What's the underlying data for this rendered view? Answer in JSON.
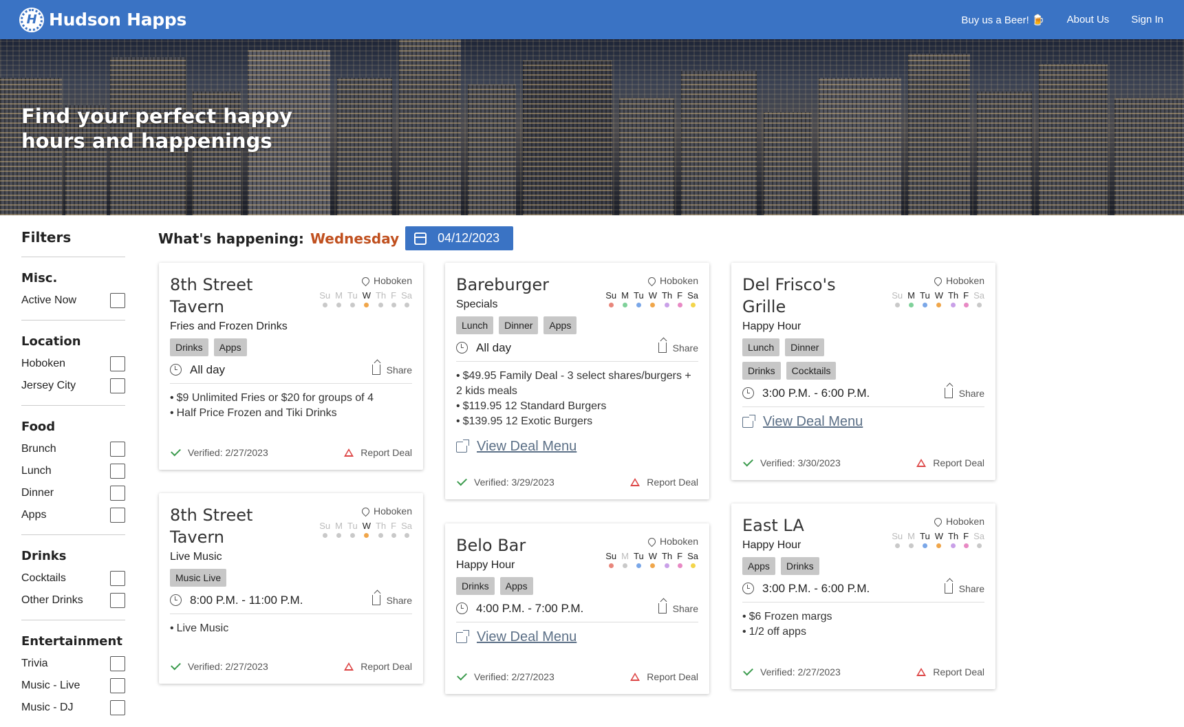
{
  "nav": {
    "brand": "Hudson Happs",
    "links": [
      "Buy us a Beer! 🍺",
      "About Us",
      "Sign In"
    ]
  },
  "hero": {
    "title_line1": "Find your perfect happy",
    "title_line2": "hours and happenings"
  },
  "filters": {
    "title": "Filters",
    "groups": [
      {
        "name": "Misc.",
        "items": [
          "Active Now"
        ]
      },
      {
        "name": "Location",
        "items": [
          "Hoboken",
          "Jersey City"
        ]
      },
      {
        "name": "Food",
        "items": [
          "Brunch",
          "Lunch",
          "Dinner",
          "Apps"
        ]
      },
      {
        "name": "Drinks",
        "items": [
          "Cocktails",
          "Other Drinks"
        ]
      },
      {
        "name": "Entertainment",
        "items": [
          "Trivia",
          "Music - Live",
          "Music - DJ"
        ]
      }
    ]
  },
  "header": {
    "label": "What's happening:",
    "day": "Wednesday",
    "date": "04/12/2023"
  },
  "colors": {
    "brand": "#3a73c4",
    "day_highlight": "#c0501f",
    "verified": "#3a9a4c",
    "report": "#dd4444"
  },
  "cards": [
    {
      "name_l1": "8th Street",
      "name_l2": "Tavern",
      "location": "Hoboken",
      "subtitle": "Fries and Frozen Drinks",
      "tags": [
        "Drinks",
        "Apps"
      ],
      "time": "All day",
      "share": "Share",
      "deals": [
        "$9 Unlimited Fries or $20 for groups of 4",
        "Half Price Frozen and Tiki Drinks"
      ],
      "verified": "Verified: 2/27/2023",
      "report": "Report Deal"
    },
    {
      "name_l1": "8th Street",
      "name_l2": "Tavern",
      "location": "Hoboken",
      "subtitle": "Live Music",
      "tags": [
        "Music Live"
      ],
      "time": "8:00 P.M. - 11:00 P.M.",
      "share": "Share",
      "deals": [
        "Live Music"
      ],
      "verified": "Verified: 2/27/2023",
      "report": "Report Deal"
    },
    {
      "name_l1": "Bareburger",
      "location": "Hoboken",
      "subtitle": "Specials",
      "tags": [
        "Lunch",
        "Dinner",
        "Apps"
      ],
      "time": "All day",
      "share": "Share",
      "deals": [
        "$49.95 Family Deal - 3 select shares/burgers + 2 kids meals",
        "$119.95 12 Standard Burgers",
        "$139.95 12 Exotic Burgers"
      ],
      "menu": "View Deal Menu",
      "verified": "Verified: 3/29/2023",
      "report": "Report Deal"
    },
    {
      "name_l1": "Belo Bar",
      "location": "Hoboken",
      "subtitle": "Happy Hour",
      "tags": [
        "Drinks",
        "Apps"
      ],
      "time": "4:00 P.M. - 7:00 P.M.",
      "share": "Share",
      "menu": "View Deal Menu",
      "verified": "Verified: 2/27/2023",
      "report": "Report Deal"
    },
    {
      "name_l1": "Del Frisco's",
      "name_l2": "Grille",
      "location": "Hoboken",
      "subtitle": "Happy Hour",
      "tags": [
        "Lunch",
        "Dinner"
      ],
      "tags2": [
        "Drinks",
        "Cocktails"
      ],
      "time": "3:00 P.M. - 6:00 P.M.",
      "share": "Share",
      "menu": "View Deal Menu",
      "verified": "Verified: 3/30/2023",
      "report": "Report Deal"
    },
    {
      "name_l1": "East LA",
      "location": "Hoboken",
      "subtitle": "Happy Hour",
      "tags": [
        "Apps",
        "Drinks"
      ],
      "time": "3:00 P.M. - 6:00 P.M.",
      "share": "Share",
      "deals": [
        "$6 Frozen margs",
        "1/2 off apps"
      ],
      "verified": "Verified: 2/27/2023",
      "report": "Report Deal"
    }
  ],
  "day_labels": [
    "Su",
    "M",
    "Tu",
    "W",
    "Th",
    "F",
    "Sa"
  ]
}
